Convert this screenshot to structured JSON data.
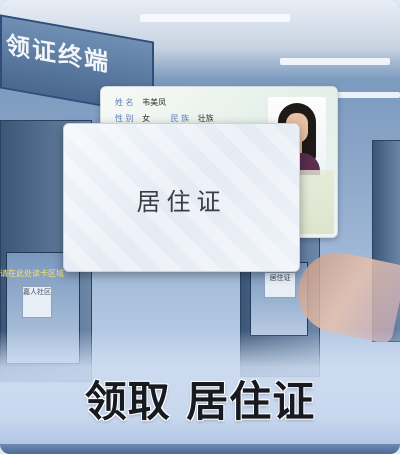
{
  "background": {
    "kiosk_sign_text": "领证终端",
    "screen_caption": "请在此处读卡区域",
    "screen_button_1": "嘉人社区",
    "screen_button_2": "居住证"
  },
  "id_card": {
    "name_key": "姓  名",
    "name_value": "韦美凤",
    "sex_key": "性  别",
    "sex_value": "女",
    "ethnicity_key": "民  族",
    "ethnicity_value": "壮族"
  },
  "overlay_card": {
    "label": "居住证"
  },
  "caption": {
    "text": "领取 居住证"
  }
}
